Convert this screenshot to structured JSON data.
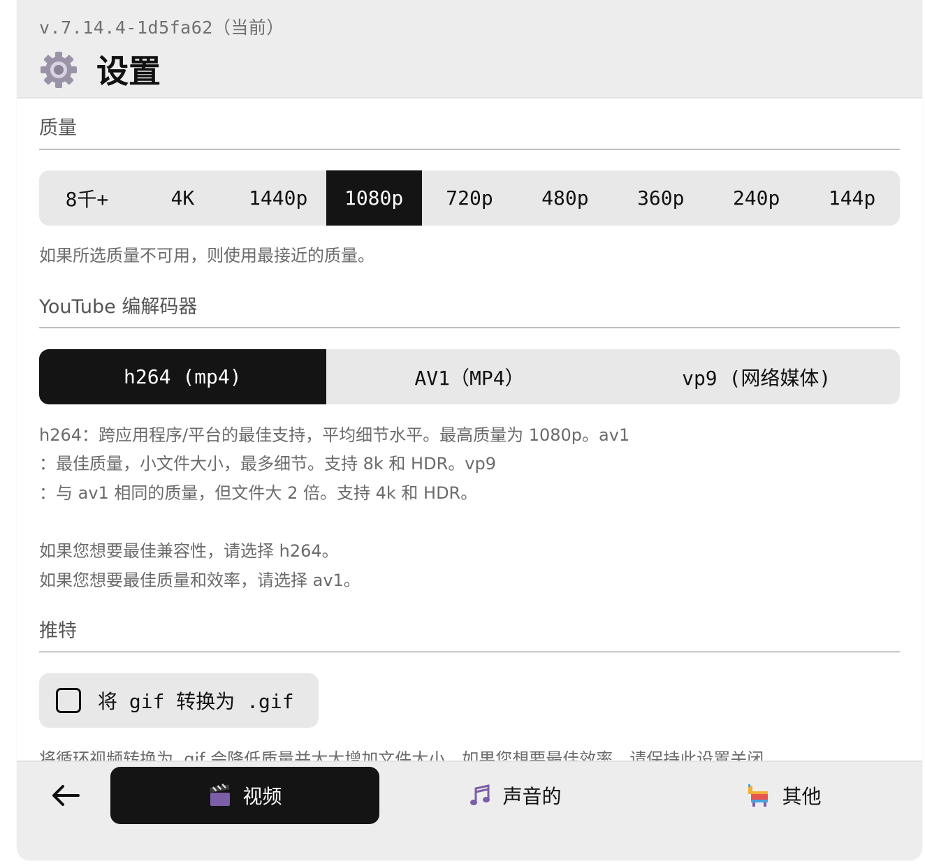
{
  "header": {
    "version": "v.7.14.4-1d5fa62（当前）",
    "title": "设置",
    "icon": "gear-icon"
  },
  "quality": {
    "title": "质量",
    "options": [
      "8千+",
      "4K",
      "1440p",
      "1080p",
      "720p",
      "480p",
      "360p",
      "240p",
      "144p"
    ],
    "selected": "1080p",
    "help": "如果所选质量不可用，则使用最接近的质量。"
  },
  "codec": {
    "title": "YouTube 编解码器",
    "options": [
      "h264 (mp4)",
      "AV1（MP4）",
      "vp9 (网络媒体)"
    ],
    "selected": "h264 (mp4)",
    "help_lines": [
      "h264：跨应用程序/平台的最佳支持，平均细节水平。最高质量为 1080p。av1",
      "：最佳质量，小文件大小，最多细节。支持 8k 和 HDR。vp9",
      "：与 av1 相同的质量，但文件大 2 倍。支持 4k 和 HDR。",
      "",
      "如果您想要最佳兼容性，请选择 h264。",
      "如果您想要最佳质量和效率，请选择 av1。"
    ]
  },
  "twitter": {
    "title": "推特",
    "checkbox_label": "将 gif 转换为 .gif",
    "checked": false,
    "help": "将循环视频转换为 .gif 会降低质量并大大增加文件大小。如果您想要最佳效率，请保持此设置关闭。"
  },
  "bottom_nav": {
    "back_icon": "arrow-left-icon",
    "tabs": [
      {
        "label": "视频",
        "icon": "clapperboard-icon",
        "active": true
      },
      {
        "label": "声音的",
        "icon": "music-notes-icon",
        "active": false
      },
      {
        "label": "其他",
        "icon": "pinata-icon",
        "active": false
      }
    ]
  },
  "colors": {
    "active_bg": "#141414",
    "segment_bg": "#e8e8e8",
    "header_bg": "#ededed"
  }
}
